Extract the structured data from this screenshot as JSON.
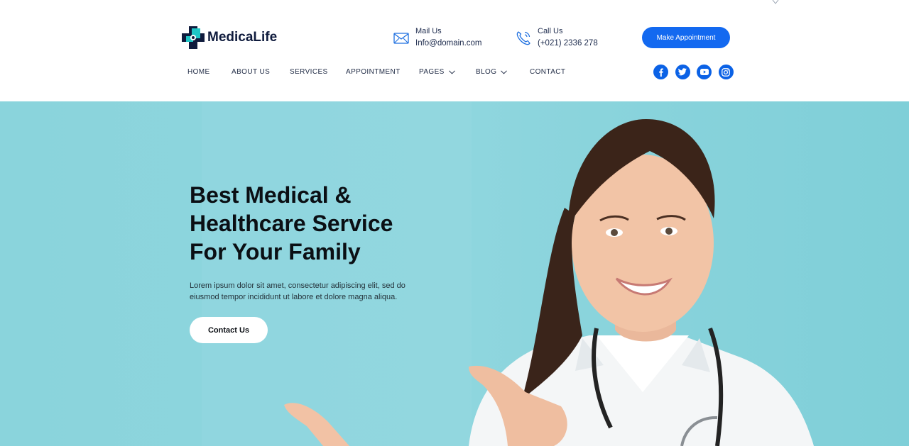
{
  "brand": {
    "name": "MedicaLife"
  },
  "contact": {
    "mail_label": "Mail Us",
    "mail_value": "Info@domain.com",
    "call_label": "Call Us",
    "call_value": "(+021) 2336 278"
  },
  "header": {
    "appointment_button": "Make Appointment"
  },
  "nav": {
    "items": [
      {
        "label": "HOME"
      },
      {
        "label": "ABOUT US"
      },
      {
        "label": "SERVICES"
      },
      {
        "label": "APPOINTMENT"
      },
      {
        "label": "PAGES"
      },
      {
        "label": "BLOG"
      },
      {
        "label": "CONTACT"
      }
    ]
  },
  "socials": [
    "facebook-icon",
    "twitter-icon",
    "youtube-icon",
    "instagram-icon"
  ],
  "hero": {
    "title_lines": [
      "Best Medical &",
      "Healthcare Service",
      "For Your Family"
    ],
    "text_lines": [
      "Lorem ipsum dolor sit amet, consectetur adipiscing elit, sed do",
      "eiusmod tempor incididunt ut labore et dolore magna aliqua."
    ],
    "button": "Contact Us"
  },
  "colors": {
    "accent": "#1369f0",
    "hero_bg": "#8dd3dc",
    "logo_teal": "#1fc6c6",
    "logo_navy": "#0f1b3d"
  }
}
